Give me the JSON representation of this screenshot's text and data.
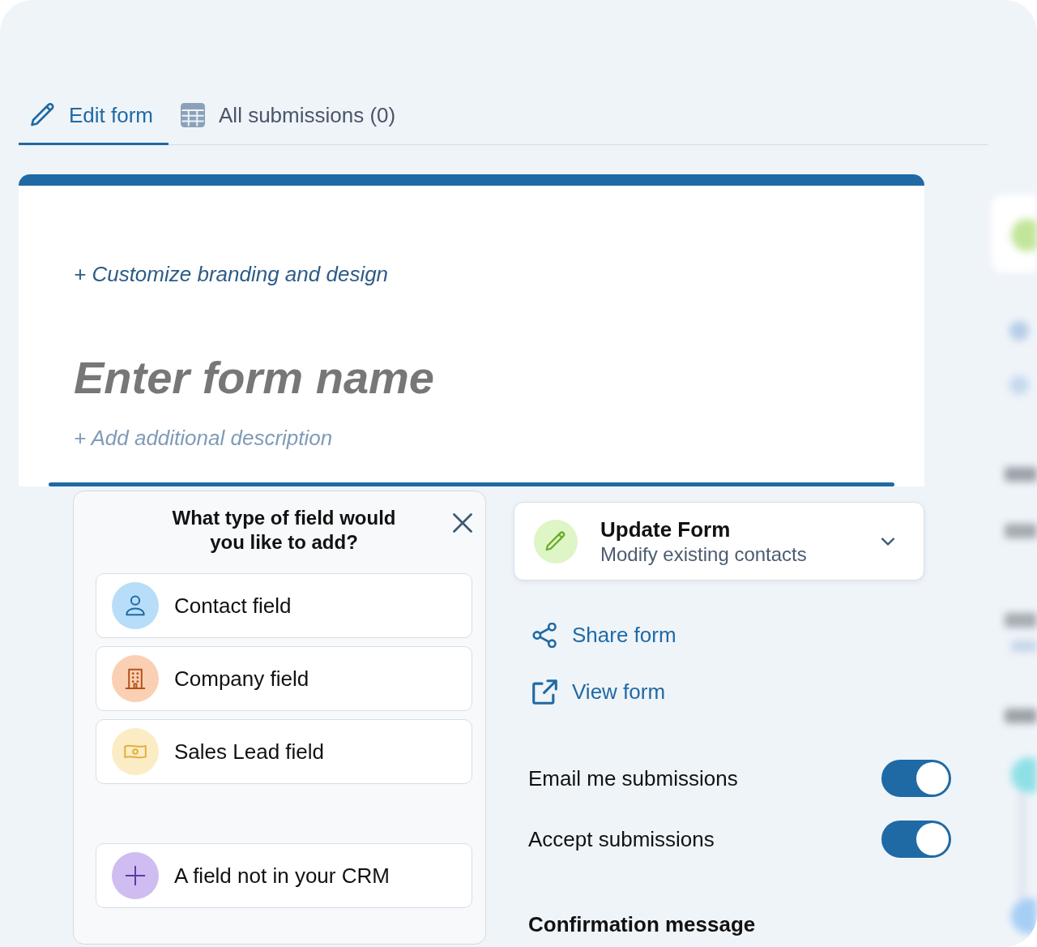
{
  "tabs": [
    {
      "label": "Edit form",
      "kind": "edit",
      "selected": true
    },
    {
      "label": "All submissions (0)",
      "kind": "table",
      "selected": false
    }
  ],
  "form": {
    "branding_link": "+ Customize branding and design",
    "name_field": {
      "placeholder": "Enter form name"
    },
    "description_link": "+ Add additional description"
  },
  "field_picker": {
    "title": "What type of field would you like to add?",
    "options": [
      {
        "label": "Contact field",
        "kind": "contact"
      },
      {
        "label": "Company field",
        "kind": "company"
      },
      {
        "label": "Sales Lead field",
        "kind": "sales_lead"
      },
      {
        "label": "A field not in your CRM",
        "kind": "custom"
      }
    ]
  },
  "form_type": {
    "title": "Update Form",
    "subtitle": "Modify existing contacts"
  },
  "links": [
    {
      "label": "Share form",
      "kind": "share"
    },
    {
      "label": "View form",
      "kind": "view"
    }
  ],
  "settings": [
    {
      "label": "Email me submissions",
      "on": true
    },
    {
      "label": "Accept submissions",
      "on": true
    }
  ],
  "confirmation": {
    "heading": "Confirmation message"
  }
}
